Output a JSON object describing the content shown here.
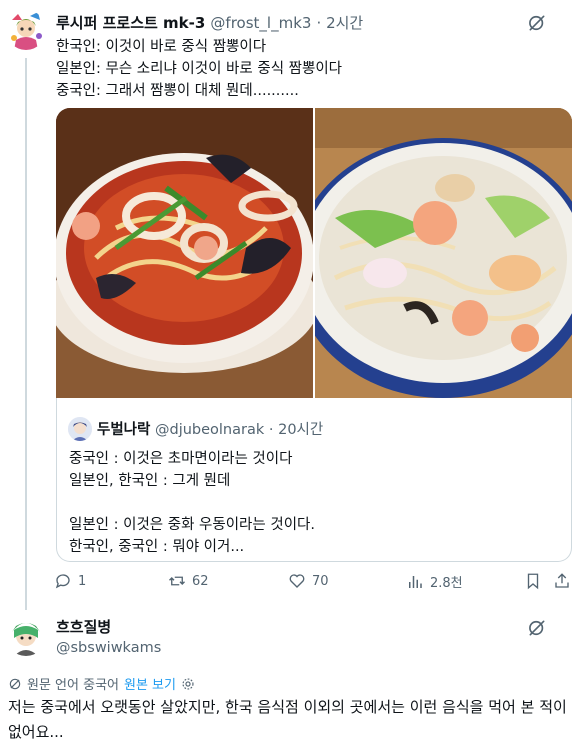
{
  "tweet": {
    "display_name": "루시퍼 프로스트 mk-3",
    "handle": "@frost_l_mk3",
    "time": "· 2시간",
    "lines": [
      "한국인: 이것이 바로 중식 짬뽕이다",
      "일본인: 무슨 소리냐 이것이 바로 중식 짬뽕이다",
      "중국인: 그래서 짬뽕이 대체 뭔데.........."
    ]
  },
  "quote": {
    "display_name": "두벌나락",
    "handle": "@djubeolnarak",
    "time": "· 20시간",
    "lines": [
      "중국인 : 이것은 초마면이라는 것이다",
      "일본인, 한국인 : 그게 뭔데",
      "",
      "일본인 : 이것은 중화 우동이라는 것이다.",
      "한국인, 중국인 : 뭐야 이거..."
    ]
  },
  "actions": {
    "replies": "1",
    "retweets": "62",
    "likes": "70",
    "views": "2.8천"
  },
  "reply": {
    "display_name": "흐흐질병",
    "handle": "@sbswiwkams",
    "translate_label": "원문 언어 중국어",
    "translate_link": "원본 보기",
    "text": "저는 중국에서 오랫동안 살았지만, 한국 음식점 이외의 곳에서는 이런 음식을 먹어 본 적이 없어요..."
  },
  "icons": {
    "grok": "grok-icon",
    "reply": "reply-icon",
    "retweet": "retweet-icon",
    "like": "heart-icon",
    "views": "views-icon",
    "bookmark": "bookmark-icon",
    "share": "share-icon",
    "translate": "translate-icon",
    "settings": "gear-icon"
  },
  "colors": {
    "text": "#0f1419",
    "secondary": "#536471",
    "accent": "#1d9bf0",
    "border": "#cfd9de"
  }
}
